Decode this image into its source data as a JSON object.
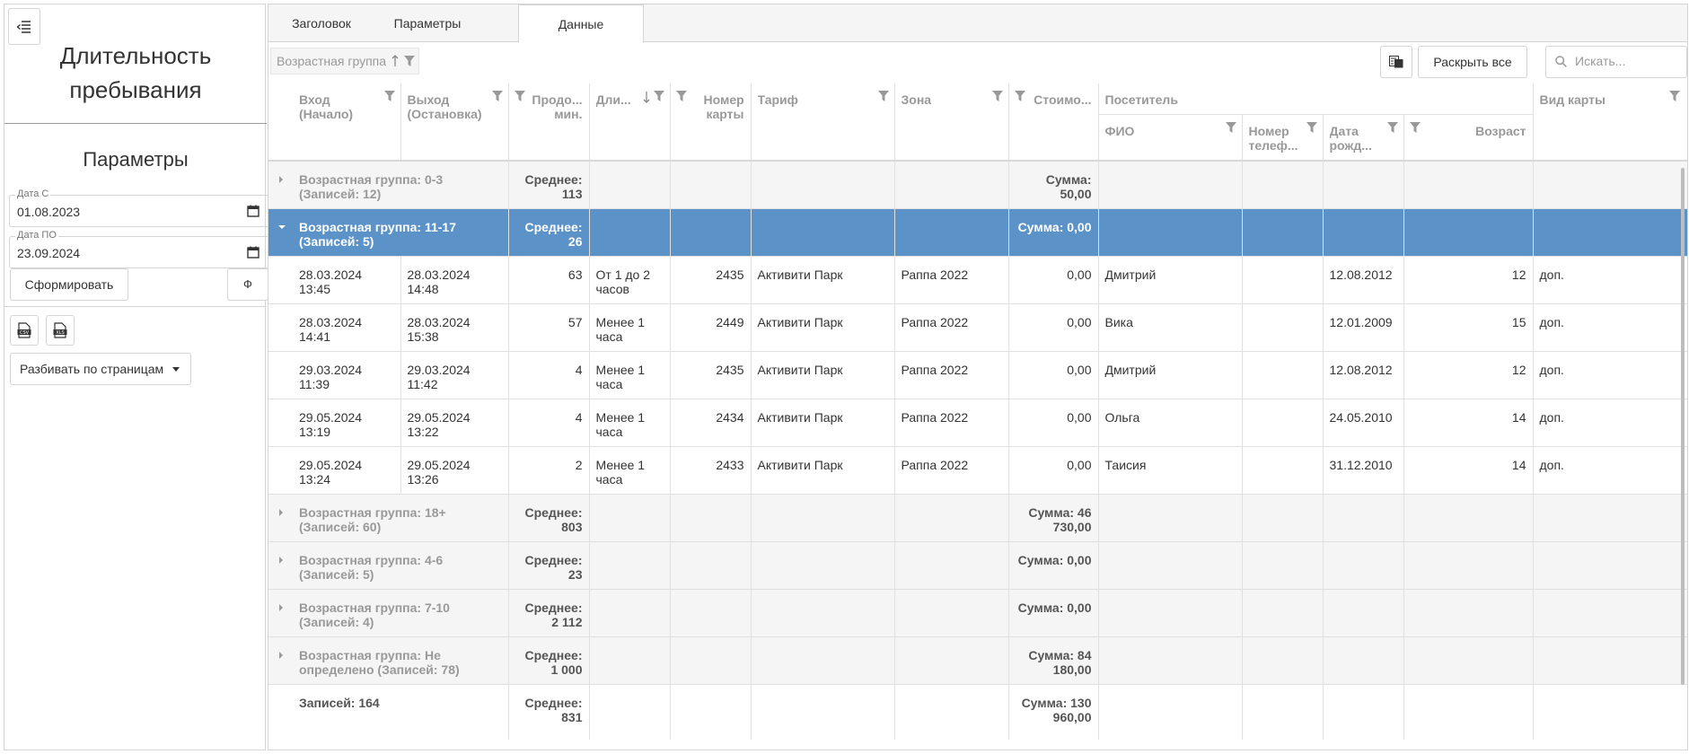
{
  "left": {
    "title": "Длительность пребывания",
    "params_title": "Параметры",
    "date_from": {
      "label": "Дата С",
      "value": "01.08.2023"
    },
    "date_to": {
      "label": "Дата ПО",
      "value": "23.09.2024"
    },
    "form_button": "Сформировать",
    "filter_button": "Ф",
    "paging_button": "Разбивать по страницам"
  },
  "tabs": [
    {
      "label": "Заголовок",
      "active": false
    },
    {
      "label": "Параметры",
      "active": false
    },
    {
      "label": "Данные",
      "active": true
    }
  ],
  "toolbar": {
    "group_chip": "Возрастная группа",
    "expand_all": "Раскрыть все",
    "search_placeholder": "Искать..."
  },
  "columns": {
    "entry": "Вход (Начало)",
    "exit": "Выход (Остановка)",
    "duration_min": "Продо... мин.",
    "duration": "Дли...",
    "card_number": "Номер карты",
    "tariff": "Тариф",
    "zone": "Зона",
    "cost": "Стоимо...",
    "visitor": "Посетитель",
    "fio": "ФИО",
    "phone": "Номер телеф...",
    "birth": "Дата рожд...",
    "age": "Возраст",
    "card_type": "Вид карты"
  },
  "groups": [
    {
      "title": "Возрастная группа: 0-3 (Записей: 12)",
      "avg": "Среднее: 113",
      "sum": "Сумма: 50,00",
      "expanded": false
    },
    {
      "title": "Возрастная группа: 11-17 (Записей: 5)",
      "avg": "Среднее: 26",
      "sum": "Сумма: 0,00",
      "expanded": true
    }
  ],
  "rows": [
    {
      "entry": "28.03.2024 13:45",
      "exit": "28.03.2024 14:48",
      "minutes": "63",
      "duration": "От 1 до 2 часов",
      "card": "2435",
      "tariff": "Активити Парк",
      "zone": "Раппа 2022",
      "cost": "0,00",
      "fio": "Дмитрий",
      "phone": "",
      "birth": "12.08.2012",
      "age": "12",
      "card_type": "доп."
    },
    {
      "entry": "28.03.2024 14:41",
      "exit": "28.03.2024 15:38",
      "minutes": "57",
      "duration": "Менее 1 часа",
      "card": "2449",
      "tariff": "Активити Парк",
      "zone": "Раппа 2022",
      "cost": "0,00",
      "fio": "Вика",
      "phone": "",
      "birth": "12.01.2009",
      "age": "15",
      "card_type": "доп."
    },
    {
      "entry": "29.03.2024 11:39",
      "exit": "29.03.2024 11:42",
      "minutes": "4",
      "duration": "Менее 1 часа",
      "card": "2435",
      "tariff": "Активити Парк",
      "zone": "Раппа 2022",
      "cost": "0,00",
      "fio": "Дмитрий",
      "phone": "",
      "birth": "12.08.2012",
      "age": "12",
      "card_type": "доп."
    },
    {
      "entry": "29.05.2024 13:19",
      "exit": "29.05.2024 13:22",
      "minutes": "4",
      "duration": "Менее 1 часа",
      "card": "2434",
      "tariff": "Активити Парк",
      "zone": "Раппа 2022",
      "cost": "0,00",
      "fio": "Ольга",
      "phone": "",
      "birth": "24.05.2010",
      "age": "14",
      "card_type": "доп."
    },
    {
      "entry": "29.05.2024 13:24",
      "exit": "29.05.2024 13:26",
      "minutes": "2",
      "duration": "Менее 1 часа",
      "card": "2433",
      "tariff": "Активити Парк",
      "zone": "Раппа 2022",
      "cost": "0,00",
      "fio": "Таисия",
      "phone": "",
      "birth": "31.12.2010",
      "age": "14",
      "card_type": "доп."
    }
  ],
  "groups_after": [
    {
      "title": "Возрастная группа: 18+ (Записей: 60)",
      "avg": "Среднее: 803",
      "sum": "Сумма: 46 730,00",
      "expanded": false
    },
    {
      "title": "Возрастная группа: 4-6 (Записей: 5)",
      "avg": "Среднее: 23",
      "sum": "Сумма: 0,00",
      "expanded": false
    },
    {
      "title": "Возрастная группа: 7-10 (Записей: 4)",
      "avg": "Среднее: 2 112",
      "sum": "Сумма: 0,00",
      "expanded": false
    },
    {
      "title": "Возрастная группа: Не определено (Записей: 78)",
      "avg": "Среднее: 1 000",
      "sum": "Сумма: 84 180,00",
      "expanded": false
    }
  ],
  "totals": {
    "records": "Записей: 164",
    "avg": "Среднее: 831",
    "sum": "Сумма: 130 960,00"
  },
  "colors": {
    "selected_row": "#5b93c9",
    "group_row": "#f5f5f5"
  }
}
